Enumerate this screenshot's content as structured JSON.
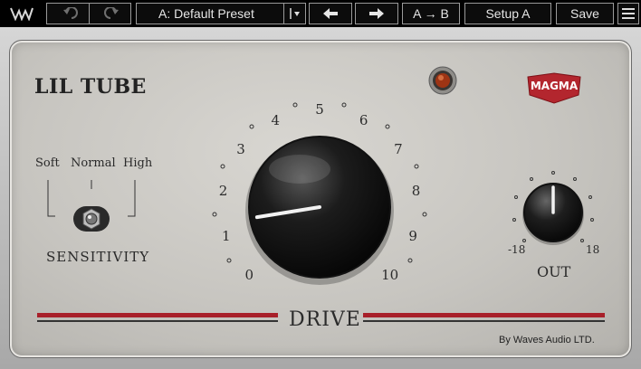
{
  "toolbar": {
    "logo_icon": "waves-logo-icon",
    "undo_icon": "undo-icon",
    "redo_icon": "redo-icon",
    "preset_name": "A: Default Preset",
    "preset_dropdown_icon": "cursor-dropdown-icon",
    "prev_icon": "arrow-left-icon",
    "next_icon": "arrow-right-icon",
    "ab_label": "A → B",
    "setup_label": "Setup A",
    "save_label": "Save",
    "menu_icon": "hamburger-menu-icon"
  },
  "plugin": {
    "title": "LIL TUBE",
    "brand": "MAGMA",
    "credit": "By Waves Audio LTD.",
    "lamp_icon": "tube-lamp-icon"
  },
  "sensitivity": {
    "title": "SENSITIVITY",
    "options": [
      "Soft",
      "Normal",
      "High"
    ],
    "selected": "Normal"
  },
  "drive": {
    "title": "DRIVE",
    "scale": [
      "0",
      "1",
      "2",
      "3",
      "4",
      "5",
      "6",
      "7",
      "8",
      "9",
      "10"
    ],
    "value": 1.3
  },
  "out": {
    "title": "OUT",
    "min_label": "-18",
    "max_label": "18",
    "value": 0
  },
  "colors": {
    "stripe_red": "#a8202a",
    "badge_red": "#b3262e",
    "lamp_orange": "#c2461c"
  }
}
